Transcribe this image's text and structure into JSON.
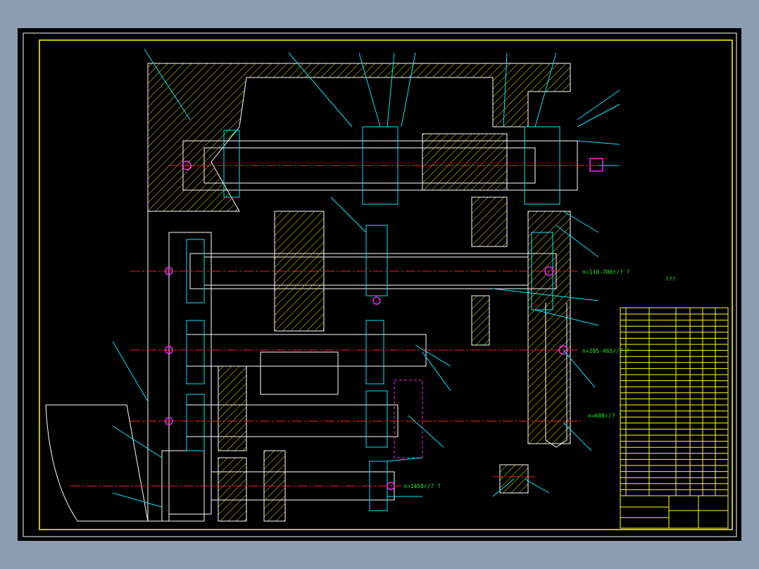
{
  "drawing": {
    "background_color": "#000000",
    "frame_color": "#ffff00",
    "outline_color": "#ffffff",
    "leader_color": "#00e5ff",
    "centerline_color": "#ff2020",
    "annotation_color": "#22ee22",
    "highlight_color": "#ff20ff",
    "speed_labels": [
      "n=110-700r/?  ?",
      "n=285-465r/?  ?",
      "n=600r/?  ?",
      "n=1450r/?  ?"
    ],
    "note_title": "???"
  }
}
